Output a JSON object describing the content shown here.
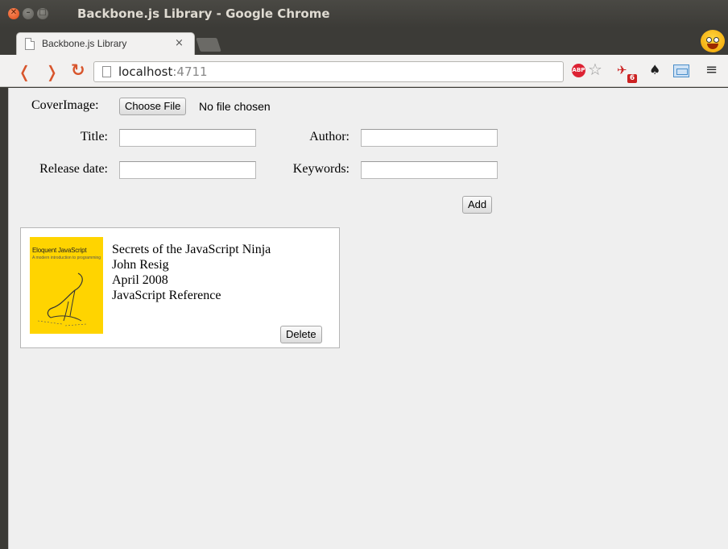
{
  "window": {
    "title": "Backbone.js Library - Google Chrome"
  },
  "tab": {
    "title": "Backbone.js Library",
    "close": "×"
  },
  "address_bar": {
    "host": "localhost",
    "port": ":4711"
  },
  "extensions": {
    "adblock_label": "ABP",
    "badge_count": "6"
  },
  "form": {
    "cover_label": "CoverImage:",
    "choose_file_label": "Choose File",
    "no_file_text": "No file chosen",
    "title_label": "Title:",
    "title_value": "",
    "author_label": "Author:",
    "author_value": "",
    "release_label": "Release date:",
    "release_value": "",
    "keywords_label": "Keywords:",
    "keywords_value": "",
    "add_label": "Add"
  },
  "books": [
    {
      "cover_title": "Eloquent JavaScript",
      "cover_subtitle": "A modern introduction to programming",
      "title": "Secrets of the JavaScript Ninja",
      "author": "John Resig",
      "release_date": "April 2008",
      "keywords": "JavaScript Reference",
      "delete_label": "Delete"
    }
  ]
}
